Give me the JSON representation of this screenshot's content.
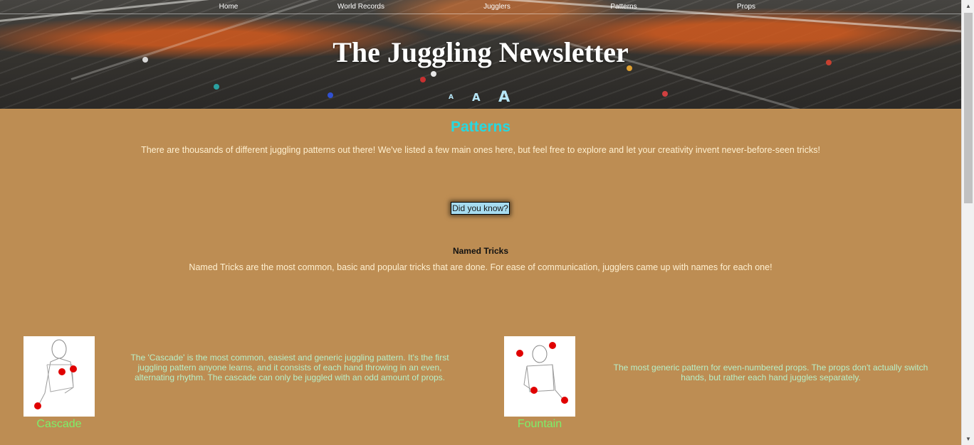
{
  "nav": {
    "items": [
      {
        "label": "Home"
      },
      {
        "label": "World Records"
      },
      {
        "label": "Jugglers"
      },
      {
        "label": "Patterns"
      },
      {
        "label": "Props"
      }
    ]
  },
  "header": {
    "title": "The Juggling Newsletter",
    "text_sizes": [
      "A",
      "A",
      "A"
    ]
  },
  "patterns": {
    "heading": "Patterns",
    "intro": "There are thousands of different juggling patterns out there! We've listed a few main ones here, but feel free to explore and let your creativity invent never-before-seen tricks!",
    "did_you_know_label": "Did you know?"
  },
  "named_tricks": {
    "heading": "Named Tricks",
    "description": "Named Tricks are the most common, basic and popular tricks that are done. For ease of communication, jugglers came up with names for each one!"
  },
  "tricks": [
    {
      "name": "Cascade",
      "description": "The 'Cascade' is the most common, easiest and generic juggling pattern. It's the first juggling pattern anyone learns, and it consists of each hand throwing in an even, alternating rhythm. The cascade can only be juggled with an odd amount of props."
    },
    {
      "name": "Fountain",
      "description": "The most generic pattern for even-numbered props. The props don't actually switch hands, but rather each hand juggles separately."
    }
  ],
  "colors": {
    "background": "#bd8d53",
    "heading_accent": "#27d8e0",
    "trick_name": "#7cf06a",
    "ball": "#e00000"
  }
}
